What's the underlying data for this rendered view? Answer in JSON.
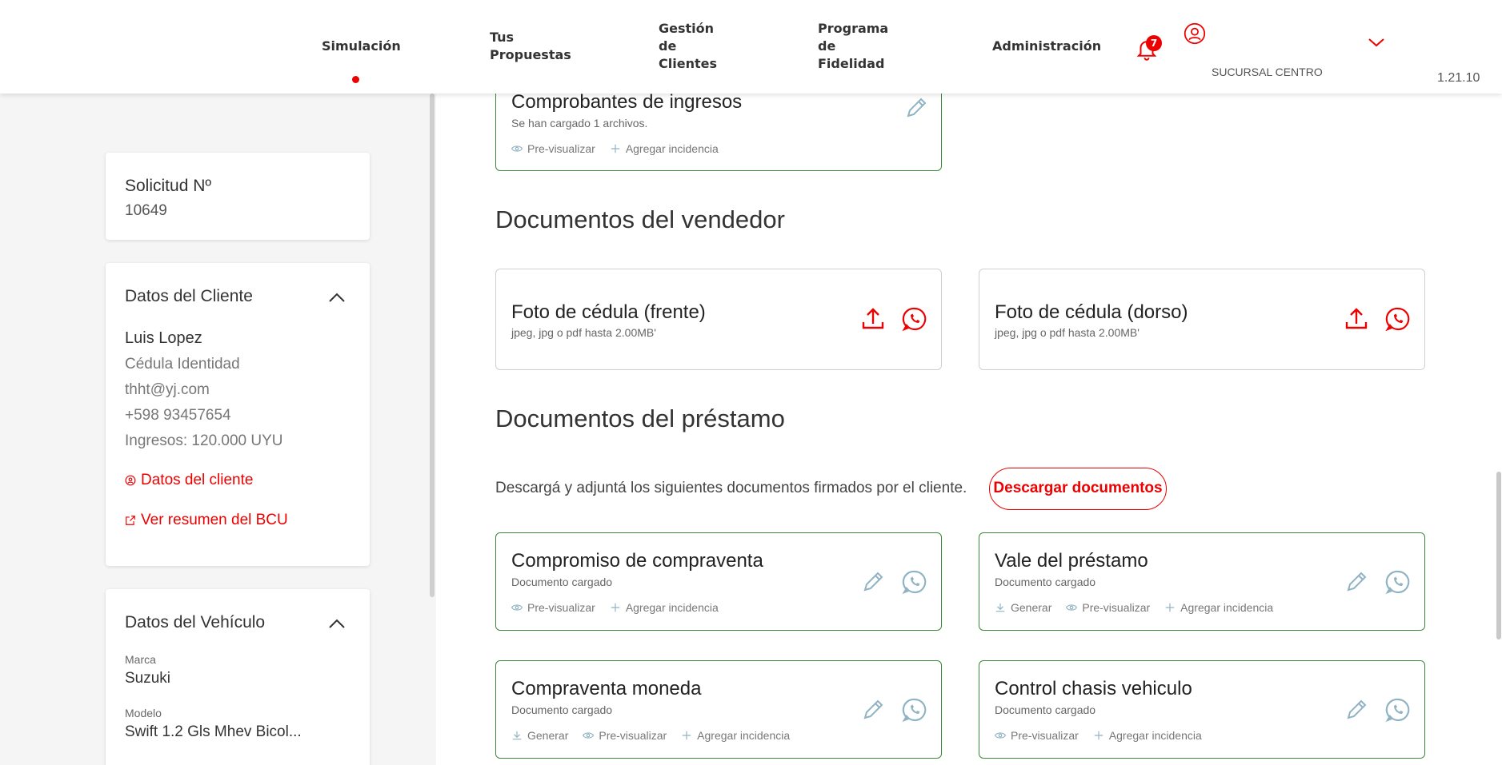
{
  "header": {
    "nav": [
      {
        "label": "Simulación",
        "active": true
      },
      {
        "label": "Tus\nPropuestas"
      },
      {
        "label": "Gestión\nde\nClientes"
      },
      {
        "label": "Programa\nde\nFidelidad"
      },
      {
        "label": "Administración"
      }
    ],
    "notifications_count": "7",
    "branch": "SUCURSAL CENTRO",
    "version": "1.21.10"
  },
  "sidebar": {
    "solicitud": {
      "label": "Solicitud Nº",
      "number": "10649"
    },
    "cliente": {
      "title": "Datos del Cliente",
      "name": "Luis Lopez",
      "doc_type": "Cédula Identidad",
      "email": "thht@yj.com",
      "phone": "+598 93457654",
      "income": "Ingresos: 120.000 UYU",
      "link_datos": "Datos del cliente",
      "link_bcu": "Ver resumen del BCU"
    },
    "vehiculo": {
      "title": "Datos del Vehículo",
      "marca_label": "Marca",
      "marca": "Suzuki",
      "modelo_label": "Modelo",
      "modelo": "Swift 1.2 Gls Mhev Bicol..."
    }
  },
  "main": {
    "comprobantes": {
      "title": "Comprobantes de ingresos",
      "sub": "Se han cargado 1 archivos.",
      "preview": "Pre-visualizar",
      "incidencia": "Agregar incidencia"
    },
    "vendedor": {
      "title": "Documentos del vendedor",
      "docs": [
        {
          "title": "Foto de cédula (frente)",
          "sub": "jpeg, jpg o pdf hasta 2.00MB'"
        },
        {
          "title": "Foto de cédula (dorso)",
          "sub": "jpeg, jpg o pdf hasta 2.00MB'"
        }
      ]
    },
    "prestamo": {
      "title": "Documentos del préstamo",
      "description": "Descargá y adjuntá los siguientes documentos firmados por el cliente.",
      "download_button": "Descargar documentos",
      "docs": [
        {
          "title": "Compromiso de compraventa",
          "sub": "Documento cargado",
          "actions": [
            "Pre-visualizar",
            "Agregar incidencia"
          ]
        },
        {
          "title": "Vale del préstamo",
          "sub": "Documento cargado",
          "actions": [
            "Generar",
            "Pre-visualizar",
            "Agregar incidencia"
          ]
        },
        {
          "title": "Compraventa moneda",
          "sub": "Documento cargado",
          "actions": [
            "Generar",
            "Pre-visualizar",
            "Agregar incidencia"
          ]
        },
        {
          "title": "Control chasis vehiculo",
          "sub": "Documento cargado",
          "actions": [
            "Pre-visualizar",
            "Agregar incidencia"
          ]
        }
      ]
    }
  },
  "colors": {
    "accent": "#ec0000",
    "success_border": "#3a8a3a",
    "icon_muted": "#8fb3c3"
  }
}
